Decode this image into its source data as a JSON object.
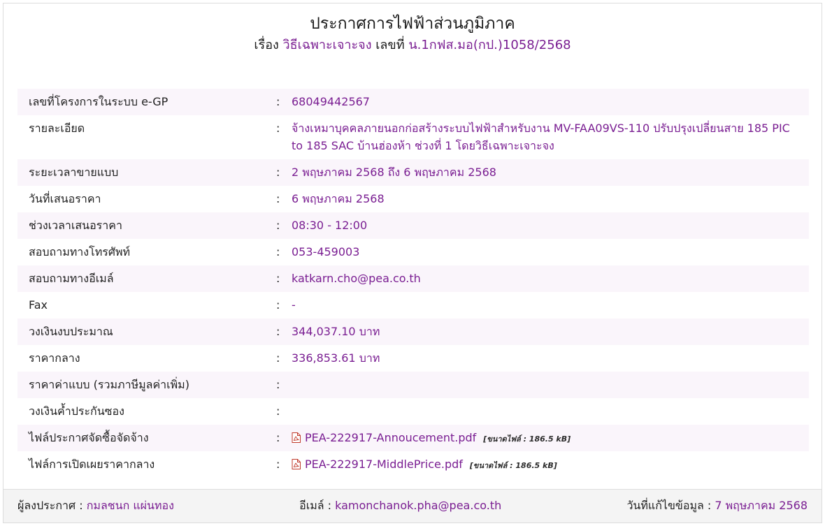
{
  "header": {
    "title": "ประกาศการไฟฟ้าส่วนภูมิภาค",
    "subject_prefix": "เรื่อง",
    "subject_method": "วิธีเฉพาะเจาะจง",
    "number_prefix": "เลขที่",
    "number_value": "น.1กฟส.มอ(กป.)1058/2568"
  },
  "details": {
    "colon": ":",
    "rows": [
      {
        "label": "เลขที่โครงการในระบบ e-GP",
        "value": "68049442567"
      },
      {
        "label": "รายละเอียด",
        "value": "จ้างเหมาบุคคลภายนอกก่อสร้างระบบไฟฟ้าสำหรับงาน MV-FAA09VS-110 ปรับปรุงเปลี่ยนสาย 185 PIC to 185 SAC บ้านฮ่องห้า ช่วงที่ 1 โดยวิธีเฉพาะเจาะจง"
      },
      {
        "label": "ระยะเวลาขายแบบ",
        "value": "2 พฤษภาคม 2568 ถึง 6 พฤษภาคม 2568"
      },
      {
        "label": "วันที่เสนอราคา",
        "value": "6 พฤษภาคม 2568"
      },
      {
        "label": "ช่วงเวลาเสนอราคา",
        "value": "08:30 - 12:00"
      },
      {
        "label": "สอบถามทางโทรศัพท์",
        "value": "053-459003"
      },
      {
        "label": "สอบถามทางอีเมล์",
        "value": "katkarn.cho@pea.co.th"
      },
      {
        "label": "Fax",
        "value": "-"
      },
      {
        "label": "วงเงินงบประมาณ",
        "value": "344,037.10 บาท"
      },
      {
        "label": "ราคากลาง",
        "value": "336,853.61 บาท"
      },
      {
        "label": "ราคาค่าแบบ (รวมภาษีมูลค่าเพิ่ม)",
        "value": ""
      },
      {
        "label": "วงเงินค้ำประกันซอง",
        "value": ""
      }
    ],
    "files": [
      {
        "label": "ไฟล์ประกาศจัดซื้อจัดจ้าง",
        "filename": "PEA-222917-Annoucement.pdf",
        "size": "[ขนาดไฟล์ : 186.5 kB]"
      },
      {
        "label": "ไฟล์การเปิดเผยราคากลาง",
        "filename": "PEA-222917-MiddlePrice.pdf",
        "size": "[ขนาดไฟล์ : 186.5 kB]"
      }
    ]
  },
  "footer": {
    "announcer_label": "ผู้ลงประกาศ :",
    "announcer_name": "กมลชนก แผ่นทอง",
    "email_label": "อีเมล์ :",
    "email_value": "kamonchanok.pha@pea.co.th",
    "updated_label": "วันที่แก้ไขข้อมูล :",
    "updated_value": "7 พฤษภาคม 2568"
  },
  "colors": {
    "accent": "#7a1e92",
    "row_alt": "#faf5fb",
    "footer_bg": "#f4f4f4"
  }
}
